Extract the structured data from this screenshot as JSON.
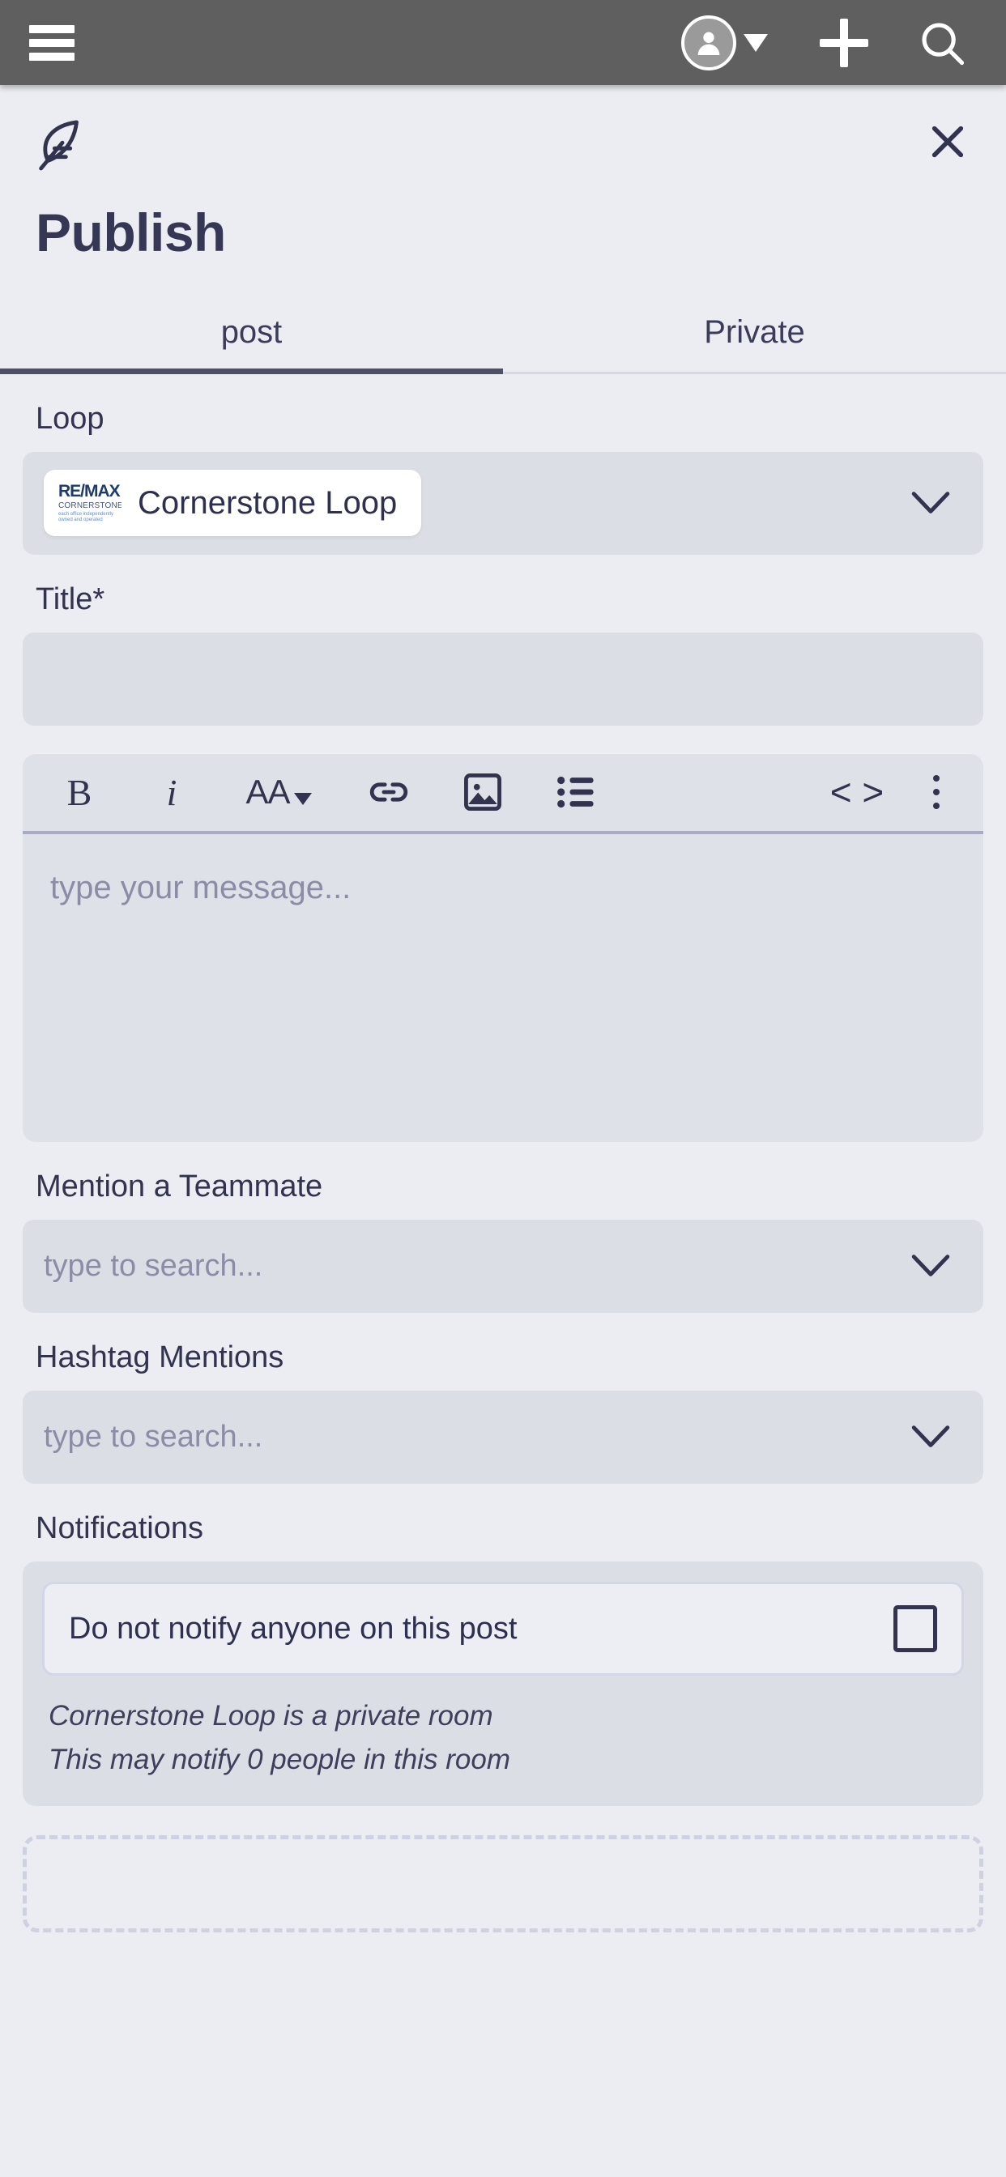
{
  "topbar": {
    "menu_icon": "hamburger-menu-icon",
    "avatar_icon": "user-avatar-icon",
    "caret_icon": "caret-down-icon",
    "add_icon": "plus-icon",
    "search_icon": "search-icon",
    "background_color": "#5f5f5f"
  },
  "panel": {
    "brand_icon": "feather-quill-icon",
    "close_icon": "close-x-icon",
    "title": "Publish",
    "accent_color": "#4e5067",
    "text_color": "#32344f"
  },
  "tabs": [
    {
      "label": "post",
      "active": true
    },
    {
      "label": "Private",
      "active": false
    }
  ],
  "form": {
    "loop": {
      "label": "Loop",
      "selected": "Cornerstone Loop",
      "logo_line1": "RE/MAX",
      "logo_line2": "CORNERSTONE",
      "logo_line3": "each office independently owned and operated",
      "chevron_icon": "chevron-down-icon"
    },
    "title": {
      "label": "Title*",
      "value": "",
      "placeholder": ""
    },
    "editor": {
      "toolbar": [
        {
          "name": "bold-button",
          "glyph": "B"
        },
        {
          "name": "italic-button",
          "glyph": "i"
        },
        {
          "name": "font-size-button",
          "glyph": "AA"
        },
        {
          "name": "link-button",
          "glyph": "link-icon"
        },
        {
          "name": "image-button",
          "glyph": "image-icon"
        },
        {
          "name": "bullet-list-button",
          "glyph": "bullet-list-icon"
        },
        {
          "name": "code-button",
          "glyph": "<>"
        },
        {
          "name": "more-options-button",
          "glyph": "vertical-dots-icon"
        }
      ],
      "bold_label": "B",
      "italic_label": "i",
      "font_size_label": "AA",
      "code_label": "< >",
      "placeholder": "type your message...",
      "value": ""
    },
    "mention": {
      "label": "Mention a Teammate",
      "placeholder": "type to search...",
      "value": "",
      "chevron_icon": "chevron-down-icon"
    },
    "hashtag": {
      "label": "Hashtag Mentions",
      "placeholder": "type to search...",
      "value": "",
      "chevron_icon": "chevron-down-icon"
    },
    "notifications": {
      "label": "Notifications",
      "option_label": "Do not notify anyone on this post",
      "checked": false,
      "note_line1": "Cornerstone Loop is a private room",
      "note_line2": "This may notify 0 people in this room"
    },
    "attachment_dropzone": {
      "name": "attachment-dropzone"
    }
  }
}
